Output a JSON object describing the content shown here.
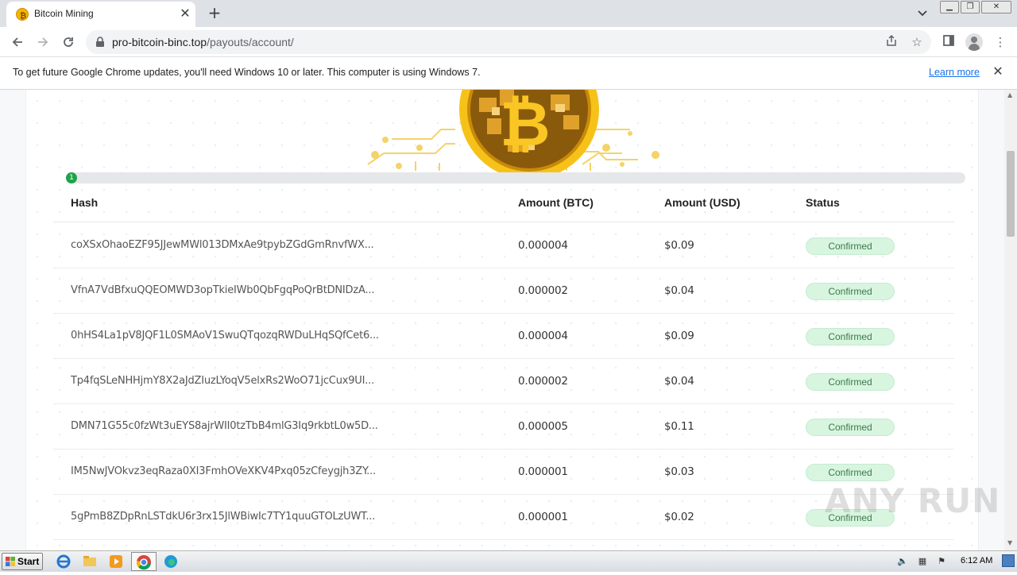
{
  "browser": {
    "tab_title": "Bitcoin Mining",
    "tab_close": "✕",
    "new_tab": "+",
    "url_domain": "pro-bitcoin-binc.top",
    "url_path": "/payouts/account/"
  },
  "infobar": {
    "message": "To get future Google Chrome updates, you'll need Windows 10 or later. This computer is using Windows 7.",
    "link": "Learn more",
    "close": "✕"
  },
  "progress": {
    "label": "1",
    "fill_percent": 1
  },
  "table": {
    "headers": [
      "Hash",
      "Amount (BTC)",
      "Amount (USD)",
      "Status"
    ],
    "rows": [
      {
        "hash": "coXSxOhaoEZF95JJewMWl013DMxAe9tpybZGdGmRnvfWX...",
        "btc": "0.000004",
        "usd": "$0.09",
        "status": "Confirmed"
      },
      {
        "hash": "VfnA7VdBfxuQQEOMWD3opTkieIWb0QbFgqPoQrBtDNIDzA...",
        "btc": "0.000002",
        "usd": "$0.04",
        "status": "Confirmed"
      },
      {
        "hash": "0hHS4La1pV8JQF1L0SMAoV1SwuQTqozqRWDuLHqSQfCet6...",
        "btc": "0.000004",
        "usd": "$0.09",
        "status": "Confirmed"
      },
      {
        "hash": "Tp4fqSLeNHHjmY8X2aJdZIuzLYoqV5elxRs2WoO71jcCux9UI...",
        "btc": "0.000002",
        "usd": "$0.04",
        "status": "Confirmed"
      },
      {
        "hash": "DMN71G55c0fzWt3uEYS8ajrWII0tzTbB4mlG3Iq9rkbtL0w5D...",
        "btc": "0.000005",
        "usd": "$0.11",
        "status": "Confirmed"
      },
      {
        "hash": "IM5NwJVOkvz3eqRaza0XI3FmhOVeXKV4Pxq05zCfeygjh3ZY...",
        "btc": "0.000001",
        "usd": "$0.03",
        "status": "Confirmed"
      },
      {
        "hash": "5gPmB8ZDpRnLSTdkU6r3rx15JlWBiwIc7TY1quuGTOLzUWT...",
        "btc": "0.000001",
        "usd": "$0.02",
        "status": "Confirmed"
      }
    ]
  },
  "watermark": "ANY RUN",
  "taskbar": {
    "start_label": "Start",
    "clock": "6:12 AM"
  },
  "colors": {
    "accent_green": "#1fa34a",
    "badge_bg": "#d8f5df",
    "badge_text": "#3b7a4b",
    "coin_gold": "#f5b400",
    "link_blue": "#1a73e8"
  },
  "icons": [
    "bitcoin-favicon-icon",
    "back-arrow-icon",
    "forward-arrow-icon",
    "reload-icon",
    "lock-icon",
    "share-icon",
    "star-icon",
    "side-panel-icon",
    "profile-icon",
    "menu-dots-icon",
    "close-icon",
    "bitcoin-coin-icon"
  ]
}
